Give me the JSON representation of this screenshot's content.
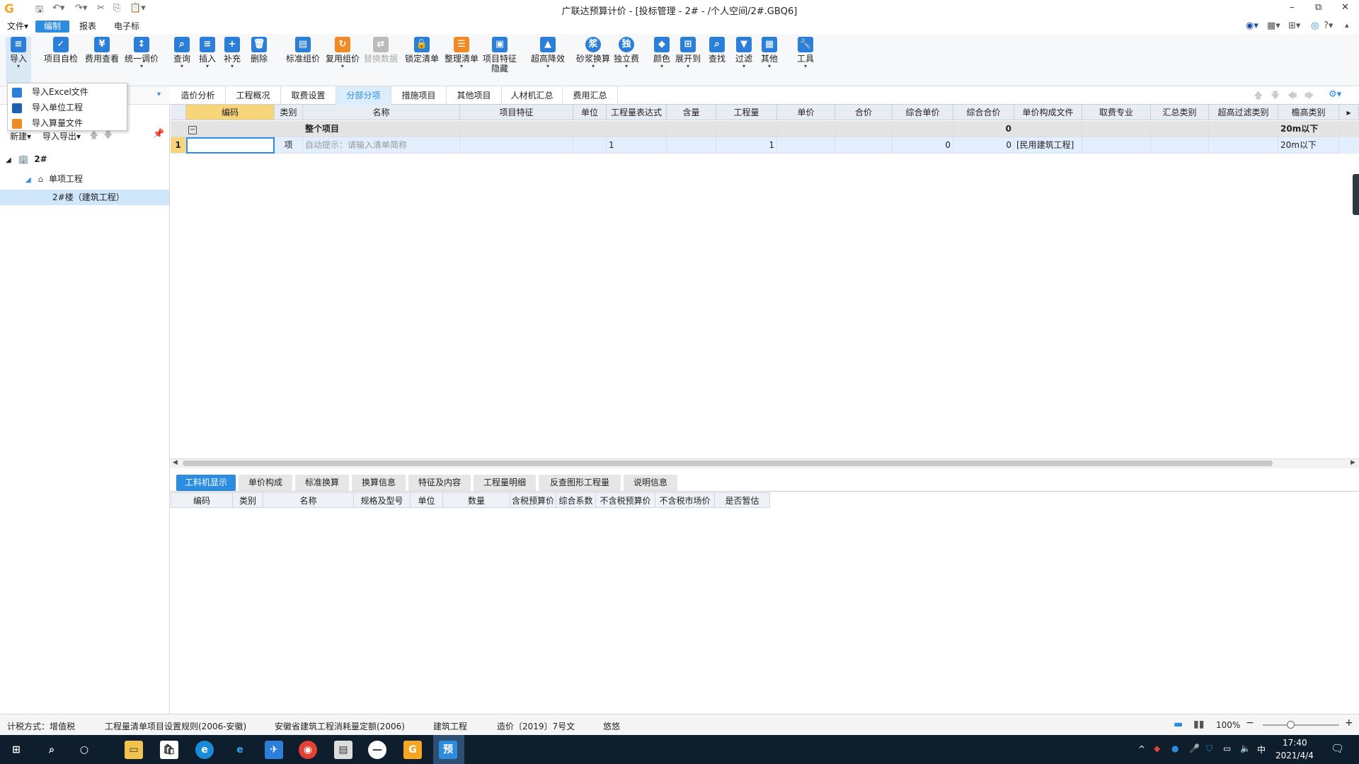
{
  "window": {
    "title": "广联达预算计价 - [投标管理 - 2# - /个人空间/2#.GBQ6]",
    "logo": "G"
  },
  "quick_access": [
    "save-icon",
    "undo-icon",
    "redo-icon",
    "cut-icon",
    "copy-icon",
    "paste-icon",
    "dropdown-icon"
  ],
  "window_buttons": [
    "–",
    "⧉",
    "✕"
  ],
  "menu": {
    "items": [
      {
        "label": "文件▾"
      },
      {
        "label": "编制",
        "active": true
      },
      {
        "label": "报表"
      },
      {
        "label": "电子标"
      }
    ]
  },
  "ribbon": {
    "buttons": [
      {
        "label": "导入",
        "has_arrow": true,
        "icon": "import-icon"
      },
      {
        "label": "项目自检",
        "icon": "check-icon"
      },
      {
        "label": "费用查看",
        "icon": "view-cost-icon"
      },
      {
        "label": "统一调价",
        "has_arrow": true,
        "icon": "adjust-price-icon"
      },
      {
        "label": "查询",
        "has_arrow": true,
        "icon": "query-icon"
      },
      {
        "label": "插入",
        "has_arrow": true,
        "icon": "insert-icon"
      },
      {
        "label": "补充",
        "has_arrow": true,
        "icon": "supplement-icon"
      },
      {
        "label": "删除",
        "icon": "delete-icon"
      },
      {
        "label": "标准组价",
        "icon": "standard-pricing-icon"
      },
      {
        "label": "复用组价",
        "has_arrow": true,
        "icon": "reuse-pricing-icon"
      },
      {
        "label": "替换数据",
        "disabled": true,
        "icon": "replace-data-icon"
      },
      {
        "label": "锁定清单",
        "icon": "lock-icon"
      },
      {
        "label": "整理清单",
        "has_arrow": true,
        "icon": "organize-list-icon"
      },
      {
        "label": "项目特征",
        "label2": "隐藏",
        "icon": "feature-hide-icon"
      },
      {
        "label": "超高降效",
        "has_arrow": true,
        "icon": "high-rise-icon"
      },
      {
        "label": "砂浆换算",
        "has_arrow": true,
        "icon": "mortar-icon"
      },
      {
        "label": "独立费",
        "has_arrow": true,
        "icon": "independent-fee-icon"
      },
      {
        "label": "颜色",
        "has_arrow": true,
        "icon": "color-icon"
      },
      {
        "label": "展开到",
        "has_arrow": true,
        "icon": "expand-icon"
      },
      {
        "label": "查找",
        "icon": "find-icon"
      },
      {
        "label": "过滤",
        "has_arrow": true,
        "icon": "filter-icon"
      },
      {
        "label": "其他",
        "has_arrow": true,
        "icon": "other-icon"
      },
      {
        "label": "工具",
        "has_arrow": true,
        "icon": "tools-icon"
      }
    ]
  },
  "import_dropdown": {
    "items": [
      {
        "label": "导入Excel文件"
      },
      {
        "label": "导入单位工程"
      },
      {
        "label": "导入算量文件"
      }
    ]
  },
  "left_panel": {
    "toolbar": {
      "new_label": "新建▾",
      "import_export_label": "导入导出▾"
    },
    "tree": [
      {
        "label": "2#",
        "level": 0
      },
      {
        "label": "单项工程",
        "level": 1
      },
      {
        "label": "2#楼（建筑工程）",
        "level": 2,
        "selected": true
      }
    ]
  },
  "tabs": [
    {
      "label": "造价分析"
    },
    {
      "label": "工程概况"
    },
    {
      "label": "取费设置"
    },
    {
      "label": "分部分项",
      "active": true
    },
    {
      "label": "措施项目"
    },
    {
      "label": "其他项目"
    },
    {
      "label": "人材机汇总"
    },
    {
      "label": "费用汇总"
    }
  ],
  "grid": {
    "columns": [
      "",
      "编码",
      "类别",
      "名称",
      "项目特征",
      "单位",
      "工程量表达式",
      "含量",
      "工程量",
      "单价",
      "合价",
      "综合单价",
      "综合合价",
      "单价构成文件",
      "取费专业",
      "汇总类别",
      "超高过滤类别",
      "檐高类别"
    ],
    "summary_row": {
      "toggle": "−",
      "name": "整个项目",
      "total": "0",
      "eave_height": "20m以下"
    },
    "rows": [
      {
        "no": "1",
        "code": "",
        "type": "项",
        "name_placeholder": "自动提示：请输入清单简称",
        "feature": "",
        "unit": "",
        "qty_expr": "1",
        "content": "",
        "qty": "1",
        "price": "",
        "amount": "",
        "unit_price": "0",
        "total_price": "0",
        "cost_file": "[民用建筑工程]",
        "fee_major": "",
        "summary_type": "",
        "high_filter": "",
        "eave_height": "20m以下"
      }
    ]
  },
  "bottom_tabs": [
    {
      "label": "工料机显示",
      "active": true
    },
    {
      "label": "单价构成"
    },
    {
      "label": "标准换算"
    },
    {
      "label": "换算信息"
    },
    {
      "label": "特征及内容"
    },
    {
      "label": "工程量明细"
    },
    {
      "label": "反查图形工程量"
    },
    {
      "label": "说明信息"
    }
  ],
  "bottom_grid": {
    "columns": [
      "编码",
      "类别",
      "名称",
      "规格及型号",
      "单位",
      "数量",
      "含税预算价",
      "综合系数",
      "不含税预算价",
      "不含税市场价",
      "是否暂估"
    ]
  },
  "status": {
    "tax": "计税方式：增值税",
    "rule": "工程量清单项目设置规则(2006-安徽)",
    "quota": "安徽省建筑工程消耗量定额(2006)",
    "type": "建筑工程",
    "doc": "造价〔2019〕7号文",
    "user": "悠悠",
    "zoom": "100%"
  },
  "taskbar": {
    "time": "17:40",
    "date": "2021/4/4",
    "ime": "中",
    "apps": [
      "start-icon",
      "search-icon",
      "cortana-icon",
      "file-explorer-icon",
      "store-icon",
      "edge-icon",
      "ie-icon",
      "bird-app-icon",
      "chrome-icon",
      "remote-desktop-icon",
      "media-icon",
      "glodon-icon",
      "estimate-app-icon"
    ],
    "active_app_label": "预"
  },
  "colors": {
    "accent": "#2b8ce0",
    "selected_header": "#f8d47a",
    "summary_row": "#e4e4e4",
    "data_row": "#e3efff",
    "taskbar": "#0f1e2d"
  }
}
